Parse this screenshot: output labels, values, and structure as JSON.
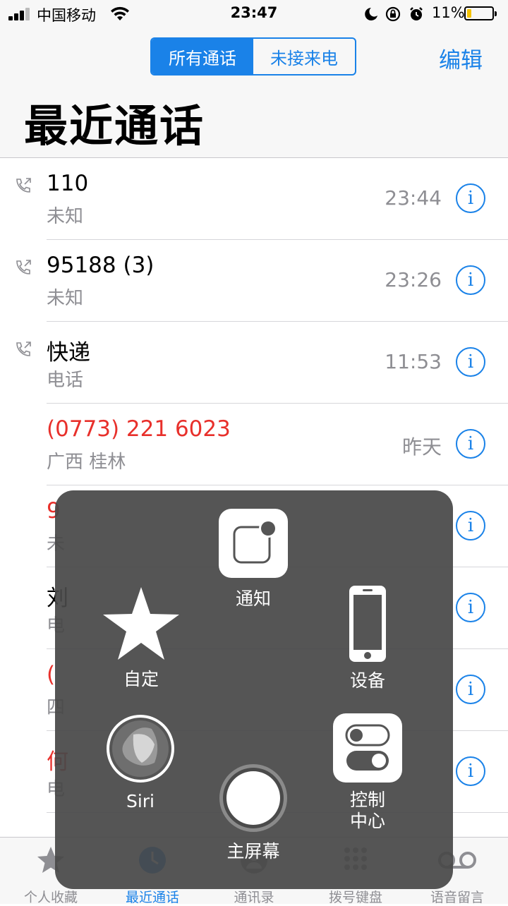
{
  "status_bar": {
    "carrier": "中国移动",
    "time": "23:47",
    "battery": "11%"
  },
  "header": {
    "segments": [
      "所有通话",
      "未接来电"
    ],
    "edit_label": "编辑",
    "title": "最近通话"
  },
  "calls": [
    {
      "name": "110",
      "subtitle": "未知",
      "time": "23:44",
      "missed": false,
      "outgoing": true
    },
    {
      "name": "95188 (3)",
      "subtitle": "未知",
      "time": "23:26",
      "missed": false,
      "outgoing": true
    },
    {
      "name": "快递",
      "subtitle": "电话",
      "time": "11:53",
      "missed": false,
      "outgoing": true
    },
    {
      "name": "(0773) 221 6023",
      "subtitle": "广西 桂林",
      "time": "昨天",
      "missed": true,
      "outgoing": false
    },
    {
      "name": "9",
      "subtitle": "未",
      "time": "",
      "missed": true,
      "outgoing": false
    },
    {
      "name": "刘",
      "subtitle": "电",
      "time": "",
      "missed": false,
      "outgoing": false
    },
    {
      "name": "(",
      "subtitle": "四",
      "time": "",
      "missed": true,
      "outgoing": false
    },
    {
      "name": "何",
      "subtitle": "电",
      "time": "",
      "missed": true,
      "outgoing": false
    }
  ],
  "tabs": [
    "个人收藏",
    "最近通话",
    "通讯录",
    "拨号键盘",
    "语音留言"
  ],
  "assistive_touch": {
    "notification": "通知",
    "custom": "自定",
    "device": "设备",
    "siri": "Siri",
    "control_center_line1": "控制",
    "control_center_line2": "中心",
    "home": "主屏幕"
  },
  "colors": {
    "accent": "#1a82e8",
    "missed": "#e8302b",
    "secondary": "#8e8e93"
  }
}
